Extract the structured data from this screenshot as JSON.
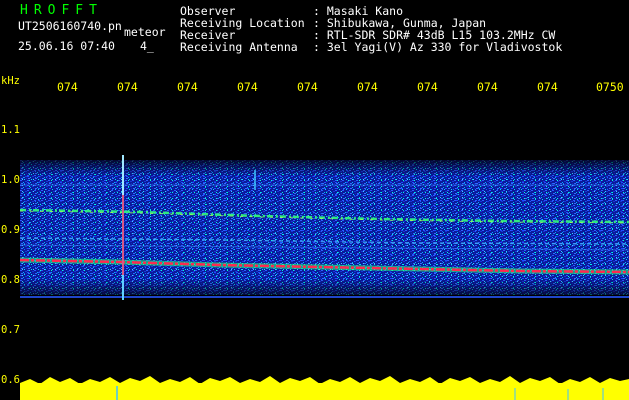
{
  "header": {
    "app_title": "HROFFT",
    "file_name": "UT2506160740.pn",
    "file_ext": "meteor",
    "file_datetime": "25.06.16 07:40",
    "file_number": "4_"
  },
  "station": {
    "labels": [
      "Observer",
      "Receiving Location",
      "Receiver",
      "Receiving Antenna"
    ],
    "values": [
      ": Masaki Kano",
      ": Shibukawa, Gunma, Japan",
      ": RTL-SDR SDR# 43dB L15 103.2MHz CW",
      ": 3el Yagi(V) Az 330 for Vladivostok"
    ]
  },
  "time_axis": {
    "labels": [
      "074",
      "074",
      "074",
      "074",
      "074",
      "074",
      "074",
      "074",
      "074",
      "0750"
    ]
  },
  "freq_axis": {
    "unit": "kHz",
    "labels": [
      "1.1",
      "1.0",
      "0.9",
      "0.8",
      "0.7",
      "0.6"
    ]
  },
  "colors": {
    "title_green": "#00ff00",
    "axis_yellow": "#ffff00",
    "noise_blue": "#1a3cff",
    "signal_red": "#ff2040"
  }
}
